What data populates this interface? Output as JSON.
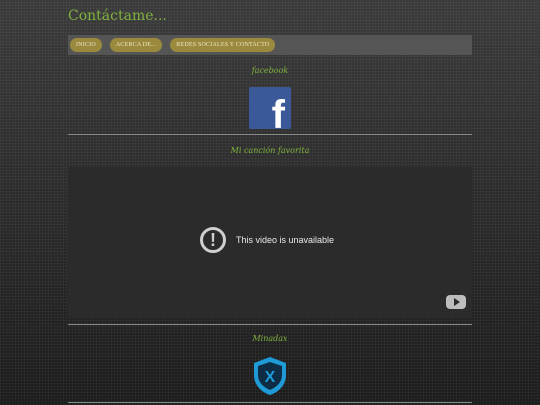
{
  "site": {
    "title": "Contáctame..."
  },
  "nav": {
    "items": [
      {
        "label": "INICIO"
      },
      {
        "label": "ACERCA DE..."
      },
      {
        "label": "REDES SOCIALES Y CONTACTO"
      }
    ]
  },
  "sections": {
    "facebook": {
      "title": "facebook",
      "icon": "facebook-icon",
      "color": "#3b5998"
    },
    "song": {
      "title": "Mi canción favorita"
    },
    "minadax": {
      "title": "Minadax",
      "icon": "shield-x-icon"
    }
  },
  "video": {
    "message": "This video is unavailable"
  },
  "colors": {
    "accent": "#7fb33e",
    "button": "#9b8a3e",
    "shield": "#1e9bd7"
  }
}
